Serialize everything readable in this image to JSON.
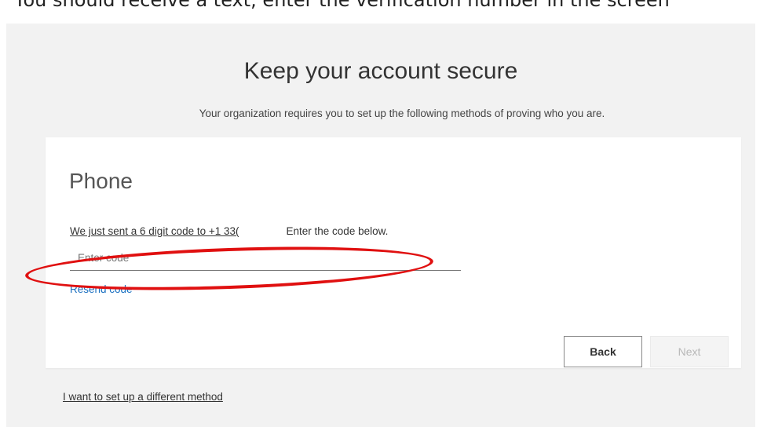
{
  "caption": "You should receive a text, enter the verification number in the screen",
  "page": {
    "title": "Keep your account secure",
    "subtitle": "Your organization requires you to set up the following methods of proving who you are."
  },
  "card": {
    "title": "Phone",
    "sent_prefix": "We just sent a 6 digit code to +1 33(",
    "sent_suffix": "Enter the code below.",
    "code_placeholder": "Enter code",
    "code_value": "",
    "resend_label": "Resend code",
    "back_label": "Back",
    "next_label": "Next"
  },
  "footer": {
    "different_method_label": "I want to set up a different method"
  },
  "colors": {
    "link": "#1a6fc0",
    "annotation": "#e01010",
    "panel_bg": "#f2f2f2"
  }
}
